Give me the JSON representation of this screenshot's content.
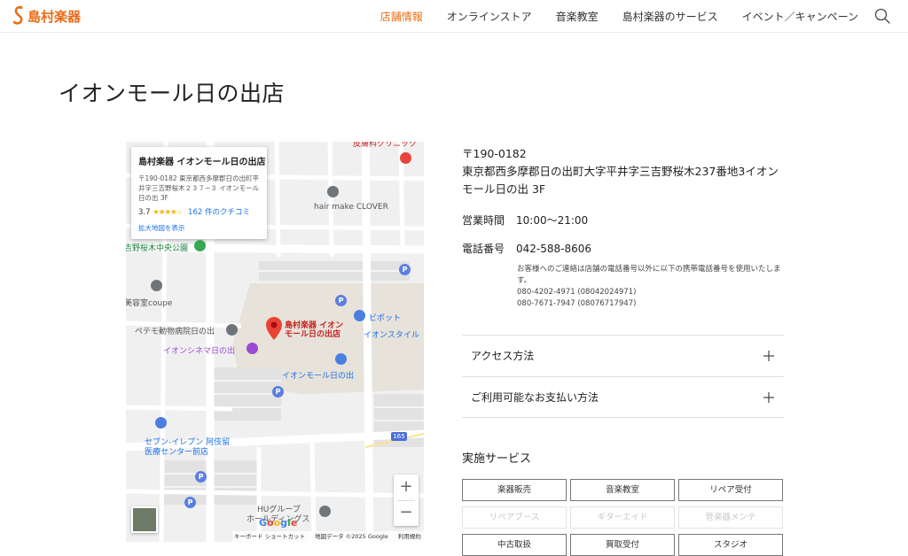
{
  "brand": {
    "name": "島村楽器",
    "accent_color": "#ea6d18"
  },
  "nav": {
    "items": [
      {
        "label": "店舗情報",
        "active": true
      },
      {
        "label": "オンラインストア",
        "active": false
      },
      {
        "label": "音楽教室",
        "active": false
      },
      {
        "label": "島村楽器のサービス",
        "active": false
      },
      {
        "label": "イベント／キャンペーン",
        "active": false
      }
    ],
    "search_icon": "search-icon"
  },
  "page": {
    "title": "イオンモール日の出店"
  },
  "map": {
    "card": {
      "title": "島村楽器 イオンモール日の出店",
      "address": "〒190-0182 東京都西多摩郡日の出町平井字三吉野桜木２３７−３ イオンモール日の出 3F",
      "rating": "3.7",
      "stars": "★★★★☆",
      "reviews": "162 件のクチコミ",
      "larger_map": "拡大地図を表示"
    },
    "pois": {
      "clinic": "皮膚科クリニック",
      "hair": "hair make CLOVER",
      "park": "吉野桜木中央公園",
      "beauty": "美容室coupe",
      "vet": "ペテモ動物病院日の出",
      "store_line1": "島村楽器 イオン",
      "store_line2": "モール日の出店",
      "bipot": "ビポット",
      "aeon_style": "イオンスタイル",
      "cinema": "イオンシネマ日の出",
      "aeon_mall": "イオンモール日の出",
      "seven_line1": "セブン-イレブン 阿伎留",
      "seven_line2": "医療センター前店",
      "hu_line1": "HUグループ",
      "hu_line2": "ホールディングス",
      "road_number": "165",
      "parking": "P"
    },
    "zoom_in": "+",
    "zoom_out": "−",
    "google": "Google",
    "footer": {
      "shortcuts": "キーボード ショートカット",
      "data": "地図データ ©2025 Google",
      "terms": "利用規約"
    }
  },
  "store": {
    "postal": "〒190-0182",
    "address": "東京都西多摩郡日の出町大字平井字三吉野桜木237番地3イオンモール日の出 3F",
    "hours_label": "営業時間",
    "hours": "10:00〜21:00",
    "phone_label": "電話番号",
    "phone": "042-588-8606",
    "note_line1": "お客様へのご連絡は店舗の電話番号以外に以下の携帯電話番号を使用いたします。",
    "note_line2": "080-4202-4971 (08042024971)",
    "note_line3": "080-7671-7947 (08076717947)"
  },
  "accordions": [
    {
      "label": "アクセス方法"
    },
    {
      "label": "ご利用可能なお支払い方法"
    }
  ],
  "services": {
    "title": "実施サービス",
    "items": [
      {
        "label": "楽器販売",
        "enabled": true
      },
      {
        "label": "音楽教室",
        "enabled": true
      },
      {
        "label": "リペア受付",
        "enabled": true
      },
      {
        "label": "リペアブース",
        "enabled": false
      },
      {
        "label": "ギターエイド",
        "enabled": false
      },
      {
        "label": "管楽器メンテ",
        "enabled": false
      },
      {
        "label": "中古取扱",
        "enabled": true
      },
      {
        "label": "買取受付",
        "enabled": true
      },
      {
        "label": "スタジオ",
        "enabled": true
      }
    ]
  }
}
